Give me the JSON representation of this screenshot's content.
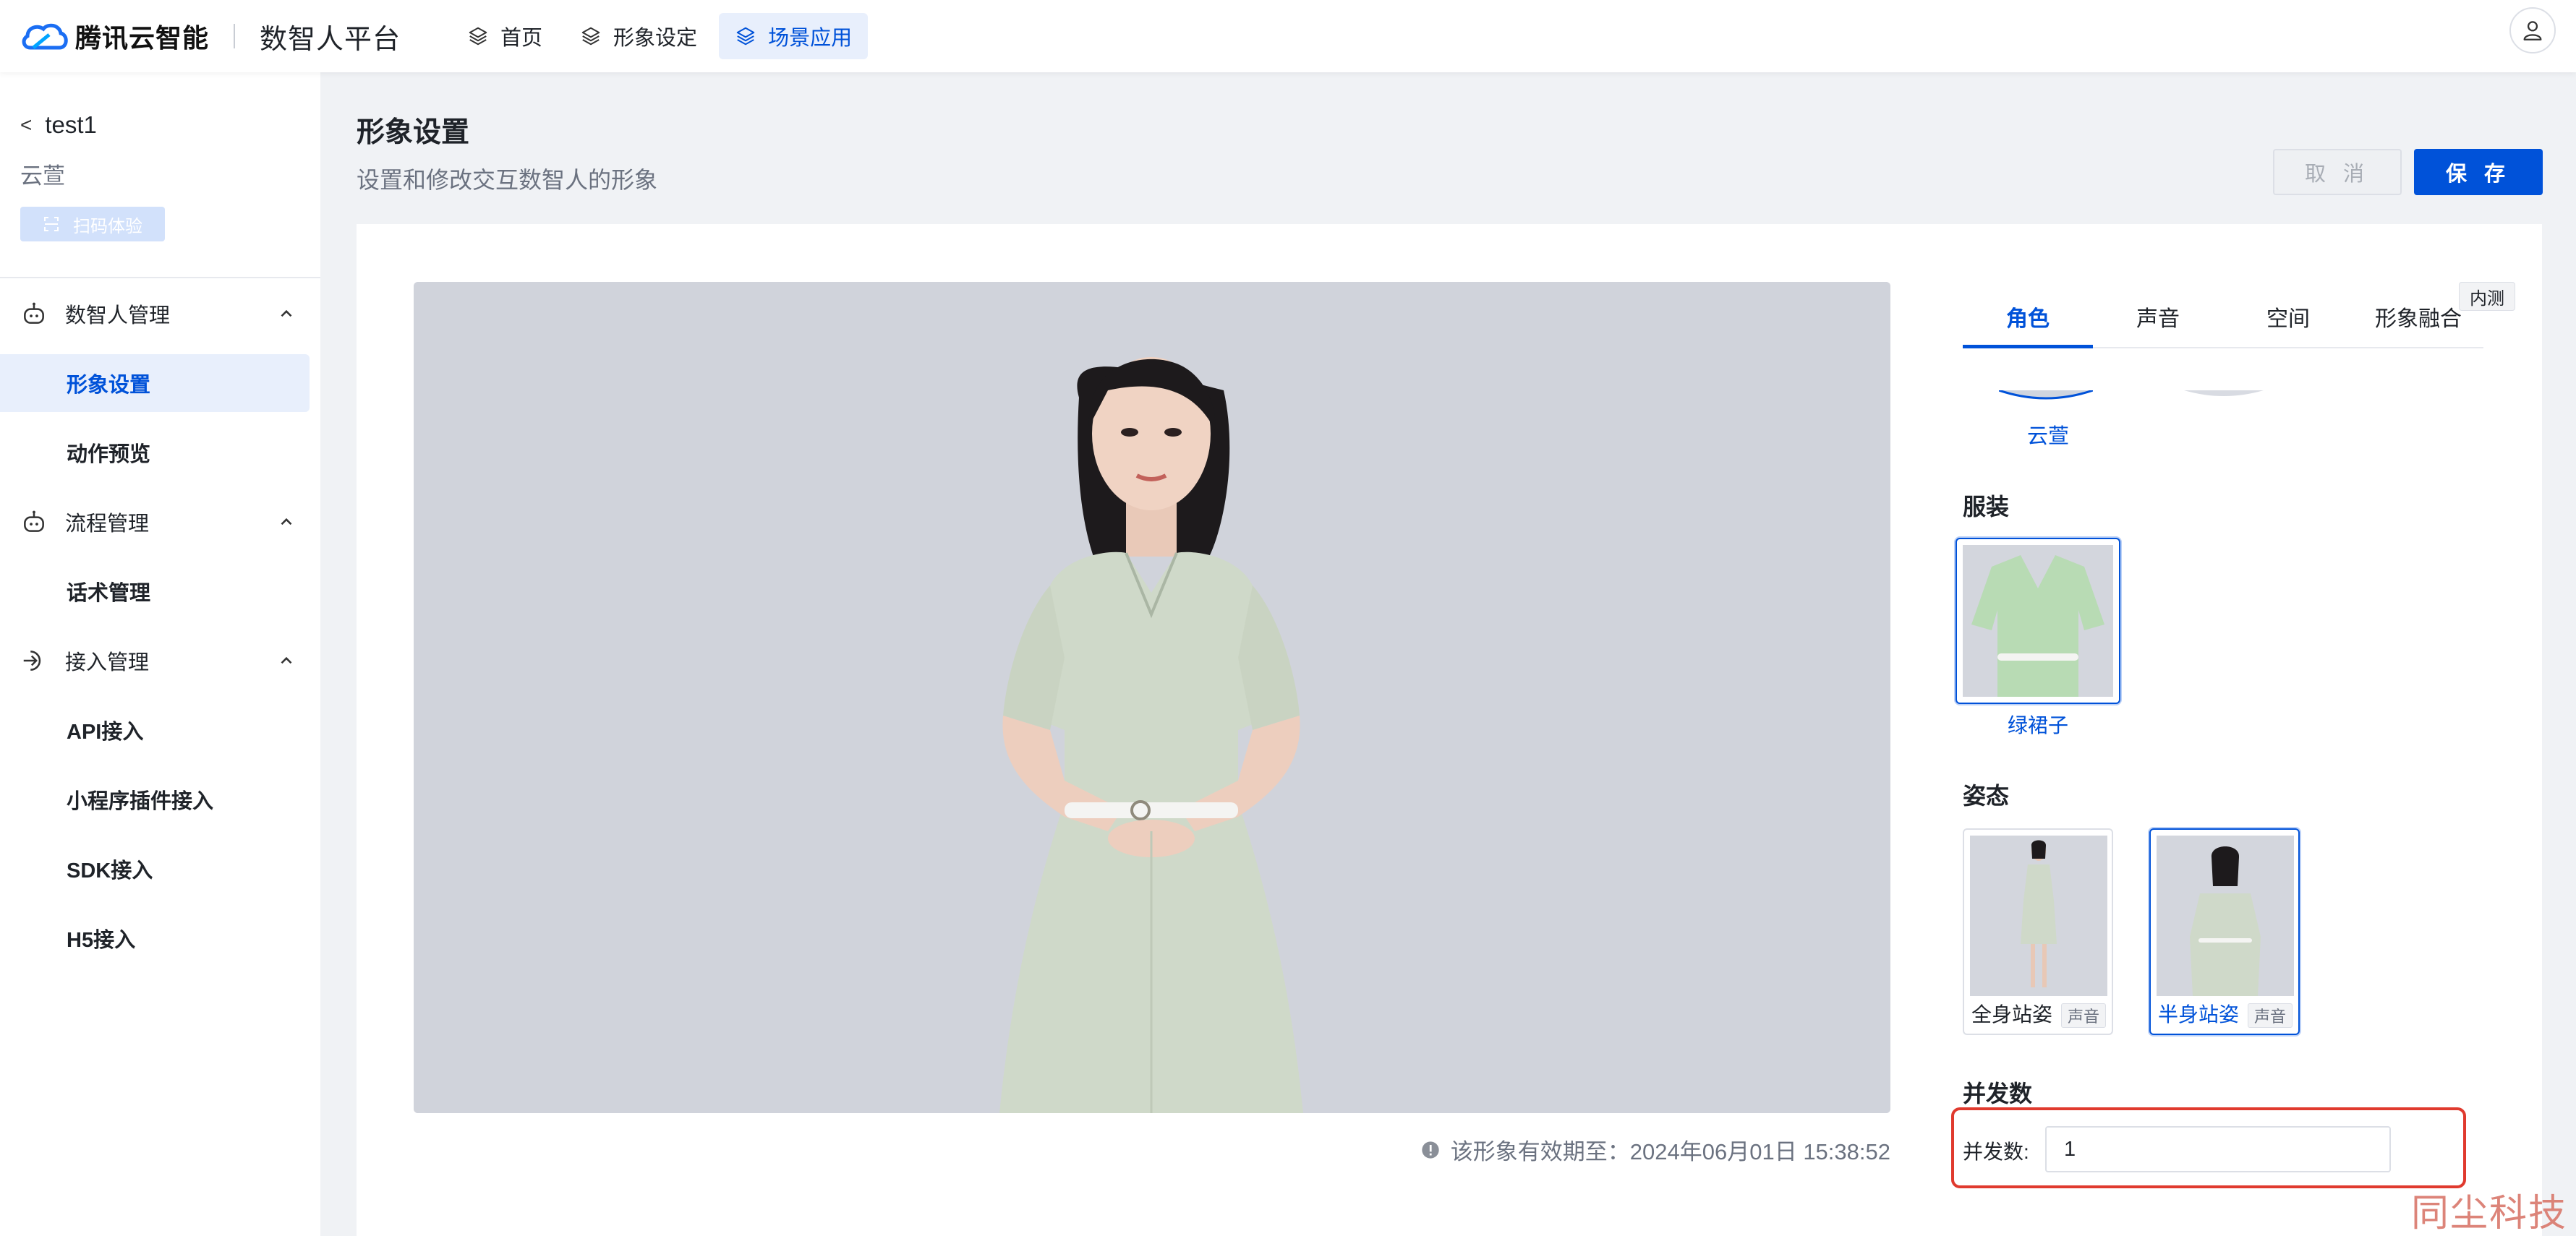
{
  "brand": {
    "name": "腾讯云智能",
    "platform": "数智人平台"
  },
  "topnav": [
    {
      "label": "首页",
      "icon": "layers-icon"
    },
    {
      "label": "形象设定",
      "icon": "layers-icon"
    },
    {
      "label": "场景应用",
      "icon": "layers-icon",
      "active": true
    }
  ],
  "sidebar": {
    "project": "test1",
    "avatar_name": "云萱",
    "scan_label": "扫码体验",
    "groups": [
      {
        "label": "数智人管理",
        "icon": "robot-icon",
        "items": [
          "形象设置",
          "动作预览"
        ]
      },
      {
        "label": "流程管理",
        "icon": "robot-icon",
        "items": [
          "话术管理"
        ]
      },
      {
        "label": "接入管理",
        "icon": "login-icon",
        "items": [
          "API接入",
          "小程序插件接入",
          "SDK接入",
          "H5接入"
        ]
      }
    ],
    "active_item": "形象设置"
  },
  "main": {
    "title": "形象设置",
    "description": "设置和修改交互数智人的形象",
    "cancel_label": "取 消",
    "save_label": "保 存",
    "validity": "该形象有效期至：2024年06月01日 15:38:52"
  },
  "panel": {
    "tabs": [
      "角色",
      "声音",
      "空间",
      "形象融合"
    ],
    "active_tab": "角色",
    "beta_badge": "内测",
    "roles": [
      {
        "name": "云萱",
        "selected": true
      }
    ],
    "costume_title": "服装",
    "costumes": [
      {
        "name": "绿裙子",
        "selected": true
      }
    ],
    "pose_title": "姿态",
    "poses": [
      {
        "name": "全身站姿",
        "tag": "声音",
        "selected": false
      },
      {
        "name": "半身站姿",
        "tag": "声音",
        "selected": true
      }
    ],
    "concurrency_title": "并发数",
    "concurrency_label": "并发数:",
    "concurrency_value": "1"
  },
  "watermark": "同尘科技",
  "colors": {
    "primary": "#0052d9",
    "highlight_border": "#e03a2e",
    "preview_bg": "#d0d3db",
    "dress": "#cfd9c9"
  }
}
